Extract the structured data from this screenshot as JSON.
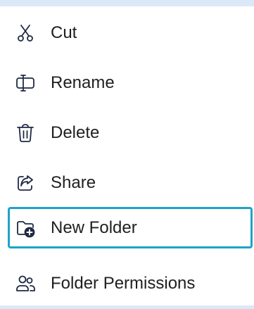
{
  "menu": {
    "items": [
      {
        "label": "Cut",
        "icon": "scissors-icon"
      },
      {
        "label": "Rename",
        "icon": "rename-icon"
      },
      {
        "label": "Delete",
        "icon": "trash-icon"
      },
      {
        "label": "Share",
        "icon": "share-icon"
      },
      {
        "label": "New Folder",
        "icon": "folder-add-icon",
        "focused": true
      },
      {
        "label": "Folder Permissions",
        "icon": "people-icon"
      }
    ]
  },
  "colors": {
    "background": "#dbe8f8",
    "menu_bg": "#ffffff",
    "text": "#1f1f1f",
    "icon": "#1f2a44",
    "focus_ring": "#1fa3c9"
  }
}
